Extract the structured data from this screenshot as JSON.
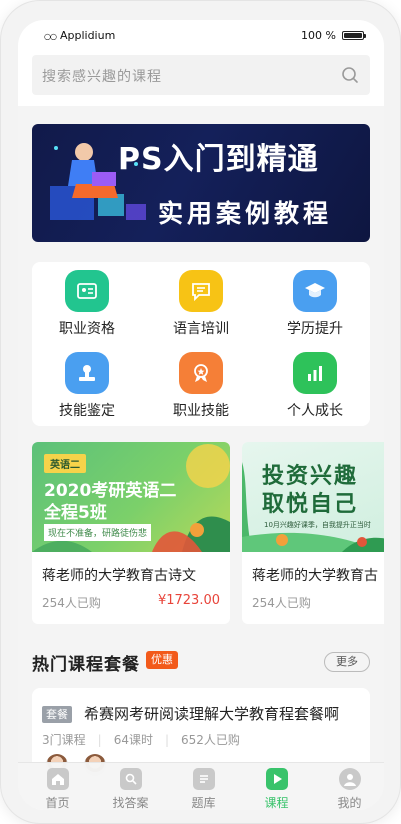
{
  "status_bar": {
    "carrier": "Applidium",
    "battery": "100 %"
  },
  "search": {
    "placeholder": "搜索感兴趣的课程"
  },
  "banner": {
    "line1": "PS入门到精通",
    "line2": "实用案例教程"
  },
  "categories": [
    {
      "label": "职业资格",
      "icon": "id-card-icon",
      "color": "#22c58f"
    },
    {
      "label": "语言培训",
      "icon": "chat-bubble-icon",
      "color": "#f7c315"
    },
    {
      "label": "学历提升",
      "icon": "graduation-cap-icon",
      "color": "#4a9ff0"
    },
    {
      "label": "技能鉴定",
      "icon": "stamp-icon",
      "color": "#4a9ff0"
    },
    {
      "label": "职业技能",
      "icon": "medal-icon",
      "color": "#f57f37"
    },
    {
      "label": "个人成长",
      "icon": "bar-chart-icon",
      "color": "#2ec25a"
    }
  ],
  "courses": [
    {
      "image_tag": "英语二",
      "image_line1": "2020考研英语二",
      "image_line2": "全程5班",
      "image_line3": "现在不准备，研路徒伤悲",
      "title": "蒋老师的大学教育古诗文",
      "purchased": "254人已购",
      "price": "¥1723.00"
    },
    {
      "image_line1": "投资兴趣",
      "image_line2": "取悦自己",
      "image_line3": "10月兴趣好课季，自我提升正当时",
      "title": "蒋老师的大学教育古",
      "purchased": "254人已购"
    }
  ],
  "hot": {
    "title": "热门课程套餐",
    "badge": "优惠",
    "more": "更多"
  },
  "package": {
    "tag": "套餐",
    "name": "希赛网考研阅读理解大学教育程套餐啊",
    "courses": "3门课程",
    "hours": "64课时",
    "purchased": "652人已购"
  },
  "tabs": [
    {
      "label": "首页",
      "icon": "home-icon"
    },
    {
      "label": "找答案",
      "icon": "search-answer-icon"
    },
    {
      "label": "题库",
      "icon": "question-bank-icon"
    },
    {
      "label": "课程",
      "icon": "play-icon",
      "active": true
    },
    {
      "label": "我的",
      "icon": "user-icon"
    }
  ],
  "colors": {
    "accent": "#39c36b",
    "price": "#e8443a",
    "badge": "#f25a1b"
  }
}
